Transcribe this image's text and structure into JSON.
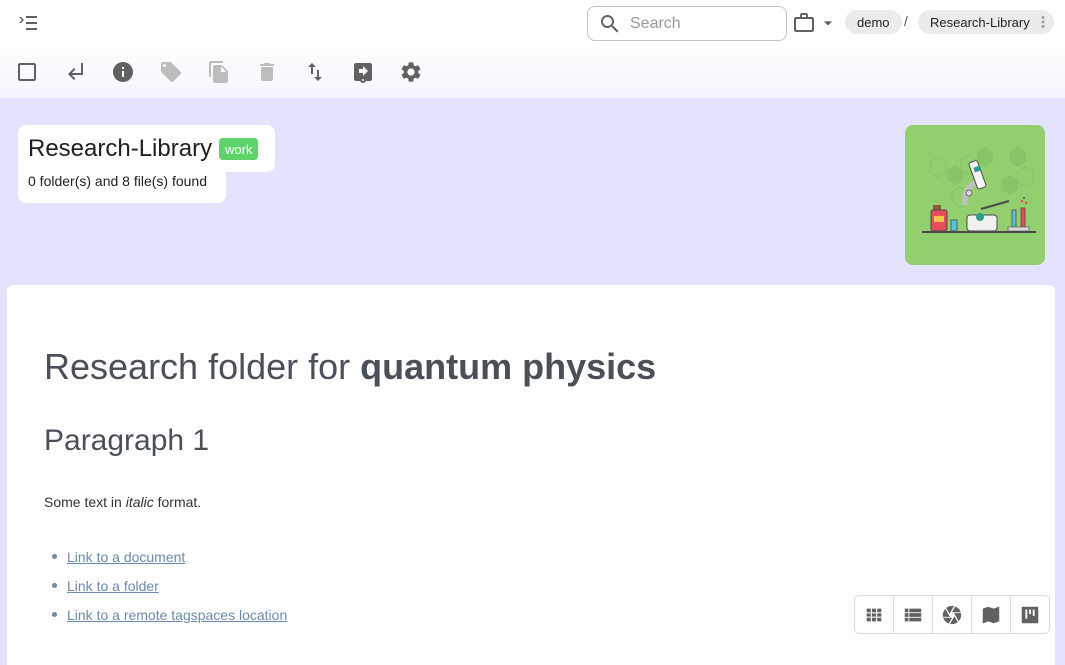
{
  "topbar": {
    "toggle_sidebar_icon": "menu-open-icon",
    "search": {
      "placeholder": "Search",
      "value": ""
    },
    "location_icon": "briefcase-icon",
    "breadcrumb": [
      {
        "label": "demo"
      },
      {
        "label": "Research-Library"
      }
    ],
    "breadcrumb_separator": "/"
  },
  "toolbar": {
    "buttons": [
      {
        "name": "select-all",
        "icon": "checkbox-outline-icon",
        "enabled": true
      },
      {
        "name": "parent-folder",
        "icon": "subdirectory-arrow-left-icon",
        "enabled": true
      },
      {
        "name": "folder-properties",
        "icon": "info-icon",
        "enabled": true
      },
      {
        "name": "tag-files",
        "icon": "tag-icon",
        "enabled": false
      },
      {
        "name": "copy-move",
        "icon": "file-copy-icon",
        "enabled": false
      },
      {
        "name": "delete",
        "icon": "delete-icon",
        "enabled": false
      },
      {
        "name": "sort",
        "icon": "swap-vert-icon",
        "enabled": true
      },
      {
        "name": "export",
        "icon": "assignment-return-icon",
        "enabled": true
      },
      {
        "name": "settings",
        "icon": "gear-icon",
        "enabled": true
      }
    ]
  },
  "folder": {
    "title": "Research-Library",
    "tag": "work",
    "tag_color": "#5ed36b",
    "summary": "0 folder(s) and 8 file(s) found",
    "thumbnail": "microscope-lab-illustration"
  },
  "description": {
    "heading_prefix": "Research folder for ",
    "heading_bold": "quantum physics",
    "subheading": "Paragraph 1",
    "para_prefix": "Some text in ",
    "para_italic": "italic",
    "para_suffix": " format.",
    "links": [
      {
        "label": "Link to a document"
      },
      {
        "label": "Link to a folder"
      },
      {
        "label": "Link to a remote tagspaces location"
      }
    ]
  },
  "perspectives": [
    {
      "name": "grid",
      "icon": "grid-view-icon"
    },
    {
      "name": "list",
      "icon": "list-view-icon"
    },
    {
      "name": "gallery",
      "icon": "camera-aperture-icon"
    },
    {
      "name": "map",
      "icon": "map-icon"
    },
    {
      "name": "kanban",
      "icon": "kanban-icon"
    }
  ],
  "colors": {
    "background": "#e3e3fd",
    "link": "#6c8ab0",
    "heading": "#4b4f58",
    "icon": "#616161",
    "icon_disabled": "#bdbdbd"
  }
}
